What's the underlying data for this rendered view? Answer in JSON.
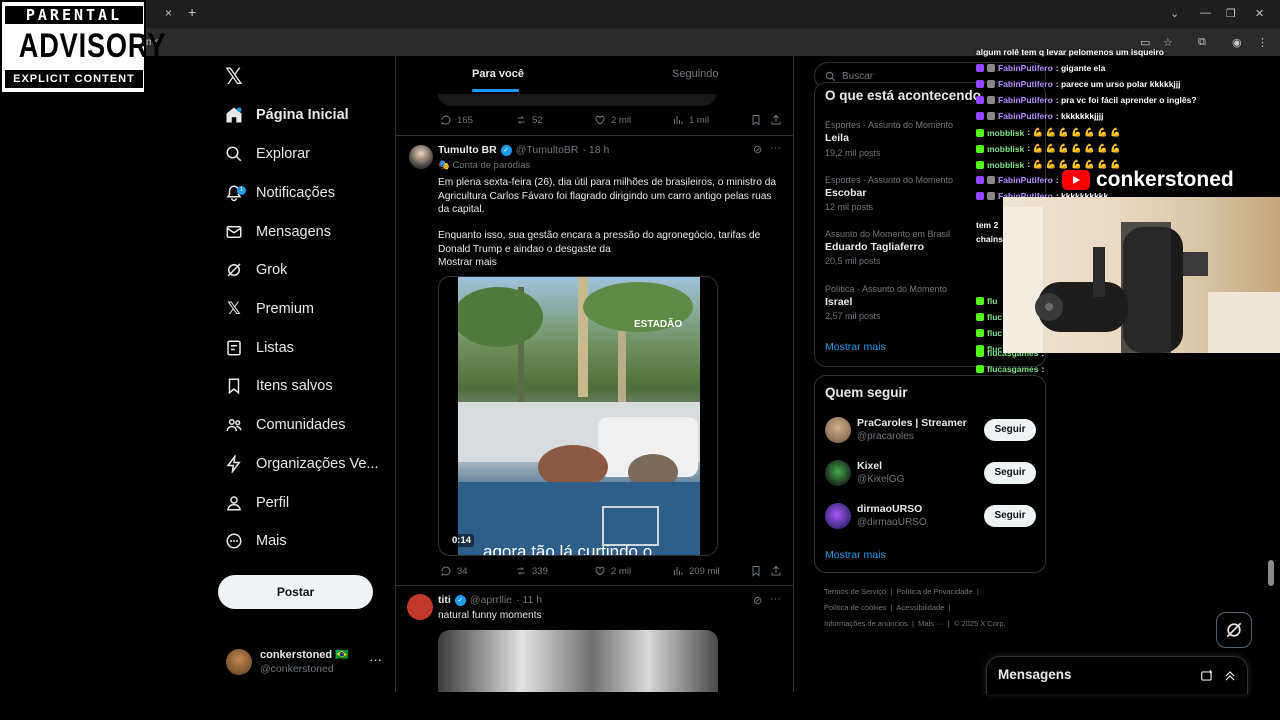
{
  "browser": {
    "url_fragment": "me",
    "tab_close": "×",
    "new_tab": "+"
  },
  "overlay_stamp": {
    "line1": "PARENTAL",
    "line2": "ADVISORY",
    "line3": "EXPLICIT CONTENT"
  },
  "nav": {
    "items": [
      {
        "label": "Página Inicial",
        "icon": "home-icon"
      },
      {
        "label": "Explorar",
        "icon": "search-icon"
      },
      {
        "label": "Notificações",
        "icon": "bell-icon",
        "badge": "1"
      },
      {
        "label": "Mensagens",
        "icon": "envelope-icon"
      },
      {
        "label": "Grok",
        "icon": "grok-icon"
      },
      {
        "label": "Premium",
        "icon": "x-icon"
      },
      {
        "label": "Listas",
        "icon": "list-icon"
      },
      {
        "label": "Itens salvos",
        "icon": "bookmark-icon"
      },
      {
        "label": "Comunidades",
        "icon": "people-icon"
      },
      {
        "label": "Organizações Ve...",
        "icon": "lightning-icon"
      },
      {
        "label": "Perfil",
        "icon": "person-icon"
      },
      {
        "label": "Mais",
        "icon": "more-circle-icon"
      }
    ],
    "post_button": "Postar",
    "account": {
      "name": "conkerstoned 🇧🇷",
      "handle": "@conkerstoned",
      "more": "···"
    }
  },
  "feed": {
    "tabs": [
      "Para você",
      "Seguindo"
    ],
    "prev_actions": {
      "replies": "165",
      "reposts": "52",
      "likes": "2 mil",
      "views": "1 mil"
    },
    "tweet1": {
      "name": "Tumulto BR",
      "handle": "@TumultoBR",
      "time": "· 18 h",
      "label": "Conta de paródias",
      "text1": "Em plena sexta-feira (26), dia útil para milhões de brasileiros, o ministro da Agricultura Carlos Fávaro foi flagrado dirigindo um carro antigo pelas ruas da capital.",
      "text2": "Enquanto isso, sua gestão encara a pressão do agronegócio, tarifas de Donald Trump e aindao o desgaste da",
      "show_more": "Mostrar mais",
      "video_watermark": "ESTADÃO",
      "video_caption": "agora tão lá curtindo o",
      "duration": "0:14",
      "actions": {
        "replies": "34",
        "reposts": "339",
        "likes": "2 mil",
        "views": "209 mil"
      }
    },
    "tweet2": {
      "name": "titi",
      "handle": "@aprrllie",
      "time": "· 11 h",
      "text": "natural funny moments"
    }
  },
  "right": {
    "search_placeholder": "Buscar",
    "trends_title": "O que está acontecendo",
    "trends": [
      {
        "category": "Esportes · Assunto do Momento",
        "name": "Leila",
        "count": "19,2 mil posts"
      },
      {
        "category": "Esportes · Assunto do Momento",
        "name": "Escobar",
        "count": "12 mil posts"
      },
      {
        "category": "Assunto do Momento em Brasil",
        "name": "Eduardo Tagliaferro",
        "count": "20,5 mil posts"
      },
      {
        "category": "Política · Assunto do Momento",
        "name": "Israel",
        "count": "2,57 mil posts"
      }
    ],
    "trends_more": "Mostrar mais",
    "who_title": "Quem seguir",
    "who": [
      {
        "name": "PraCaroles | Streamer",
        "handle": "@pracaroles",
        "button": "Seguir"
      },
      {
        "name": "Kixel",
        "handle": "@KixelGG",
        "button": "Seguir"
      },
      {
        "name": "dirmaoURSO",
        "handle": "@dirmaoURSO",
        "button": "Seguir"
      }
    ],
    "who_more": "Mostrar mais",
    "footer": [
      "Termos de Serviço",
      "Política de Privacidade",
      "Política de cookies",
      "Acessibilidade",
      "Informações de anúncios",
      "Mais ···",
      "© 2025 X Corp."
    ]
  },
  "chat": {
    "lines": [
      {
        "user": "",
        "msg": "algum rolê tem q levar pelomenos um isqueiro",
        "color": "white"
      },
      {
        "user": "FabinPutifero",
        "msg": ": gigante ela",
        "color": "purple"
      },
      {
        "user": "FabinPutifero",
        "msg": ": parece um urso polar kkkkkjjj",
        "color": "purple"
      },
      {
        "user": "FabinPutifero",
        "msg": ": pra vc foi fácil aprender o inglês?",
        "color": "purple"
      },
      {
        "user": "FabinPutifero",
        "msg": ": kkkkkkkjjjj",
        "color": "purple"
      },
      {
        "user": "mobblisk",
        "msg": ": 💪 💪 💪 💪 💪 💪 💪",
        "color": "green"
      },
      {
        "user": "mobblisk",
        "msg": ": 💪 💪 💪 💪 💪 💪 💪",
        "color": "green"
      },
      {
        "user": "mobblisk",
        "msg": ": 💪 💪 💪 💪 💪 💪 💪",
        "color": "green"
      },
      {
        "user": "FabinPutifero",
        "msg": ":",
        "color": "purple"
      },
      {
        "user": "FabinPutifero",
        "msg": ": kkkkkkkkkk",
        "color": "purple"
      },
      {
        "user": "",
        "msg": "tem 2",
        "color": "white"
      },
      {
        "user": "",
        "msg": "chains",
        "color": "white"
      }
    ],
    "bottom_lines": [
      {
        "user": "flucasgames",
        "msg": ":",
        "color": "green"
      },
      {
        "user": "flucasgames",
        "msg": ":",
        "color": "green"
      }
    ],
    "fragments": [
      "flu",
      "fluc",
      "fluc",
      "fluc"
    ]
  },
  "stream": {
    "channel": "conkerstoned"
  },
  "messages_drawer": {
    "title": "Mensagens"
  }
}
